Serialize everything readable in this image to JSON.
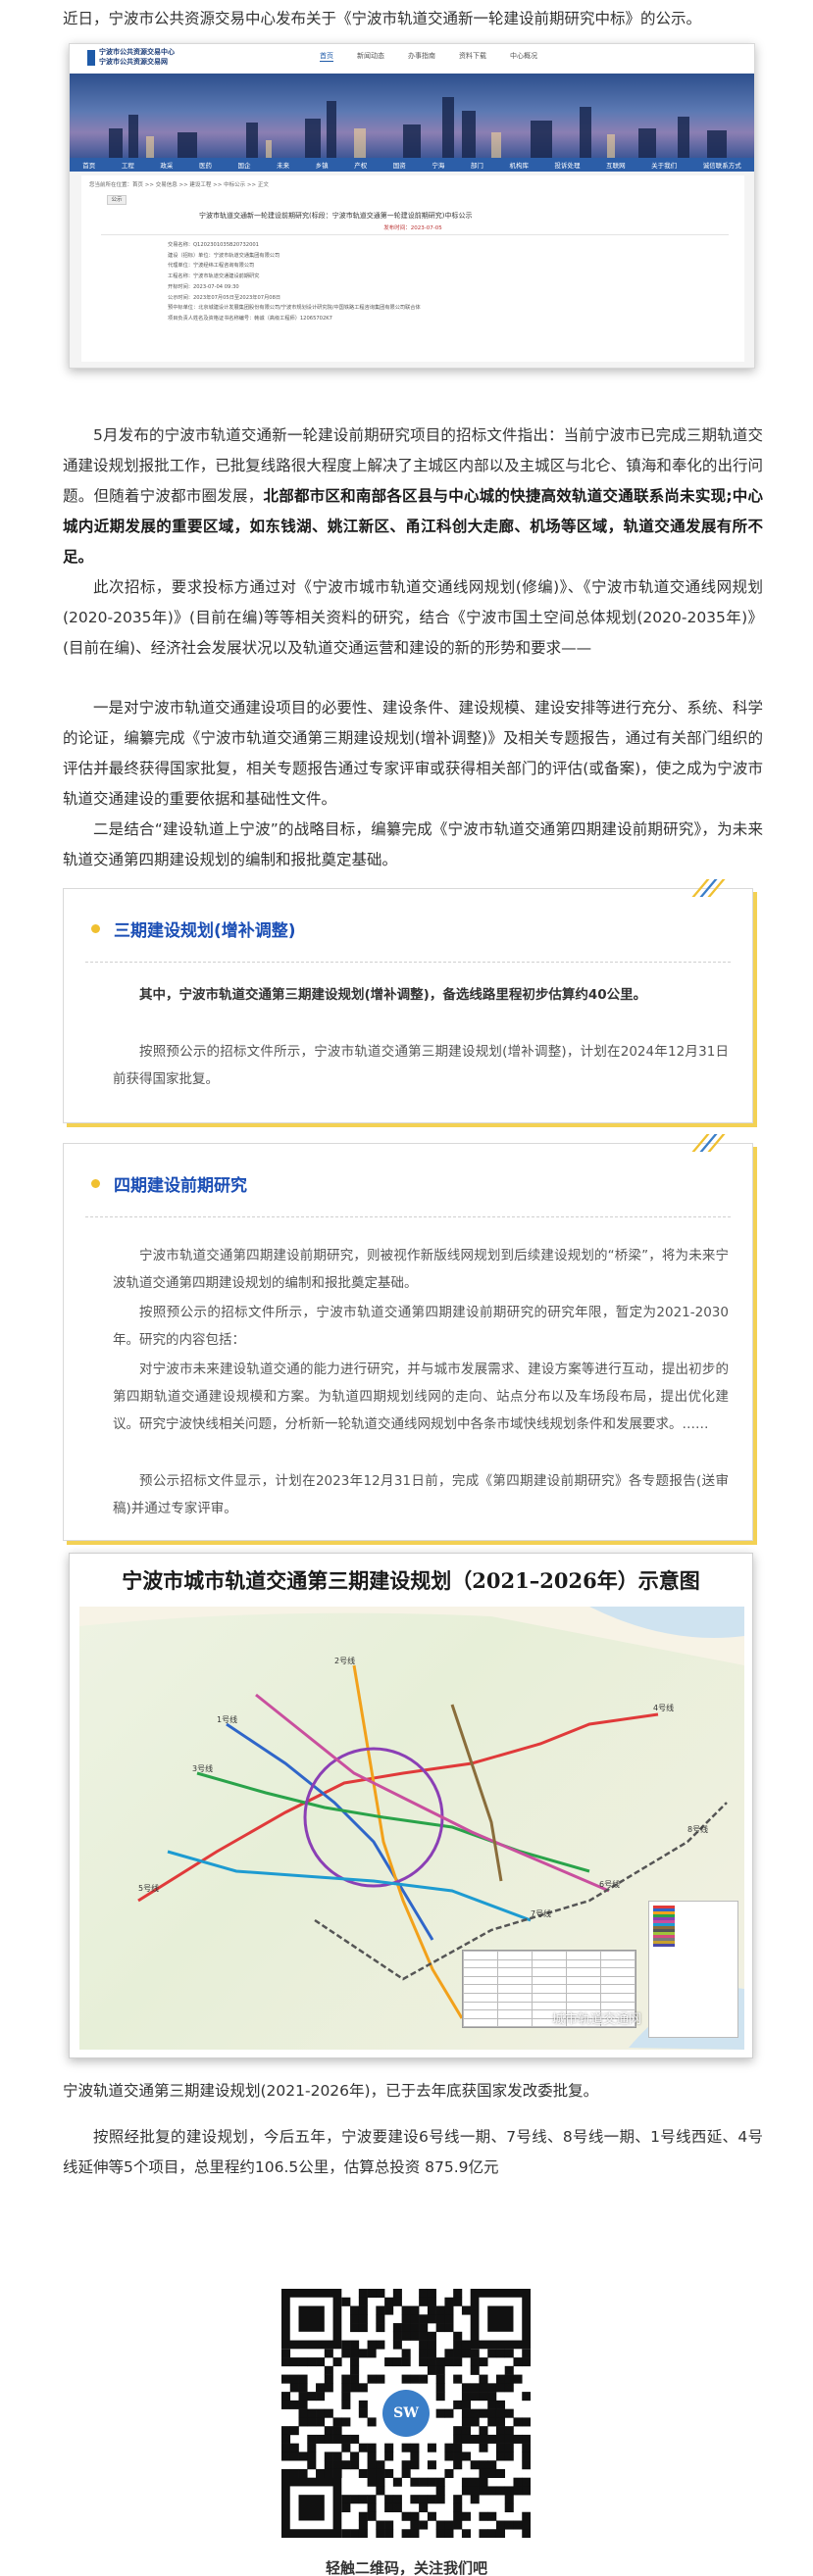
{
  "intro": "近日，宁波市公共资源交易中心发布关于《宁波市轨道交通新一轮建设前期研究中标》的公示。",
  "screenshot": {
    "org_line1": "宁波市公共资源交易中心",
    "org_line2": "宁波市公共资源交易网",
    "nav": [
      "首页",
      "新闻动态",
      "办事指南",
      "资料下载",
      "中心概况"
    ],
    "menu": [
      "首页",
      "工程",
      "政采",
      "医药",
      "国企",
      "未来",
      "乡镇",
      "产权",
      "国资",
      "宁海",
      "部门",
      "机构库",
      "投诉处理",
      "互联网",
      "关于我们",
      "诚信联系方式"
    ],
    "breadcrumb": "您当前所在位置：首页 >> 交易信息 >> 建设工程 >> 中标公示 >> 正文",
    "tag": "公示",
    "title": "宁波市轨道交通新一轮建设前期研究(标段：宁波市轨道交通第一轮建设前期研究)中标公示",
    "date": "发布时间：2023-07-05",
    "details": [
      "交易名称：Q1202301035B20732001",
      "建设（招标）单位：宁波市轨道交通集团有限公司",
      "代理单位：宁波经纬工程咨询有限公司",
      "工程名称：宁波市轨道交通建设前期研究",
      "开标时间：2023-07-04 09:30",
      "公示时间：2023年07月05日至2023年07月08日",
      "预中标单位：北京城建设计发展集团股份有限公司/宁波市规划设计研究院/中国铁路工程咨询集团有限公司联合体",
      "项目负责人姓名及资格证书名称编号：韩诚（高级工程师）12065702K7"
    ]
  },
  "para1": {
    "normal": "5月发布的宁波市轨道交通新一轮建设前期研究项目的招标文件指出：当前宁波市已完成三期轨道交通建设规划报批工作，已批复线路很大程度上解决了主城区内部以及主城区与北仑、镇海和奉化的出行问题。但随着宁波都市圈发展，",
    "bold": "北部都市区和南部各区县与中心城的快捷高效轨道交通联系尚未实现;中心城内近期发展的重要区域，如东钱湖、姚江新区、甬江科创大走廊、机场等区域，轨道交通发展有所不足。"
  },
  "para2": "此次招标，要求投标方通过对《宁波市城市轨道交通线网规划(修编)》、《宁波市轨道交通线网规划(2020-2035年)》(目前在编)等等相关资料的研究，结合《宁波市国土空间总体规划(2020-2035年)》(目前在编)、经济社会发展状况以及轨道交通运营和建设的新的形势和要求——",
  "para3": "一是对宁波市轨道交通建设项目的必要性、建设条件、建设规模、建设安排等进行充分、系统、科学的论证，编纂完成《宁波市轨道交通第三期建设规划(增补调整)》及相关专题报告，通过有关部门组织的评估并最终获得国家批复，相关专题报告通过专家评审或获得相关部门的评估(或备案)，使之成为宁波市轨道交通建设的重要依据和基础性文件。",
  "para4": "二是结合“建设轨道上宁波”的战略目标，编纂完成《宁波市轨道交通第四期建设前期研究》，为未来轨道交通第四期建设规划的编制和报批奠定基础。",
  "box1": {
    "title": "三期建设规划(增补调整)",
    "p1": "其中，宁波市轨道交通第三期建设规划(增补调整)，备选线路里程初步估算约40公里。",
    "p2": "按照预公示的招标文件所示，宁波市轨道交通第三期建设规划(增补调整)，计划在2024年12月31日前获得国家批复。"
  },
  "box2": {
    "title": "四期建设前期研究",
    "p1": "宁波市轨道交通第四期建设前期研究，则被视作新版线网规划到后续建设规划的“桥梁”，将为未来宁波轨道交通第四期建设规划的编制和报批奠定基础。",
    "p2": "按照预公示的招标文件所示，宁波市轨道交通第四期建设前期研究的研究年限，暂定为2021-2030年。研究的内容包括：",
    "p3": "对宁波市未来建设轨道交通的能力进行研究，并与城市发展需求、建设方案等进行互动，提出初步的第四期轨道交通建设规模和方案。为轨道四期规划线网的走向、站点分布以及车场段布局，提出优化建议。研究宁波快线相关问题，分析新一轮轨道交通线网规划中各条市域快线规划条件和发展要求。……",
    "p4": "预公示招标文件显示，计划在2023年12月31日前，完成《第四期建设前期研究》各专题报告(送审稿)并通过专家评审。"
  },
  "map": {
    "title": "宁波市城市轨道交通第三期建设规划（2021–2026年）示意图",
    "line_labels": [
      "1号线",
      "2号线",
      "3号线",
      "4号线",
      "5号线",
      "6号线",
      "7号线",
      "8号线"
    ],
    "legend_colors": [
      "#e03a3a",
      "#2f66c9",
      "#f2a11b",
      "#2aa34a",
      "#8b3fb5",
      "#c94f9e",
      "#1d9bd1",
      "#8a6d3b",
      "#555555",
      "#9fc43a",
      "#d64b7c",
      "#7a7a7a",
      "#c7a02d",
      "#4a4aa8"
    ],
    "watermark": "城市轨道交通网"
  },
  "caption": "宁波轨道交通第三期建设规划(2021-2026年)，已于去年底获国家发改委批复。",
  "para5": "按照经批复的建设规划，今后五年，宁波要建设6号线一期、7号线、8号线一期、1号线西延、4号线延伸等5个项目，总里程约106.5公里，估算总投资 875.9亿元",
  "qr": {
    "center": "SW",
    "caption": "轻触二维码，关注我们吧"
  }
}
